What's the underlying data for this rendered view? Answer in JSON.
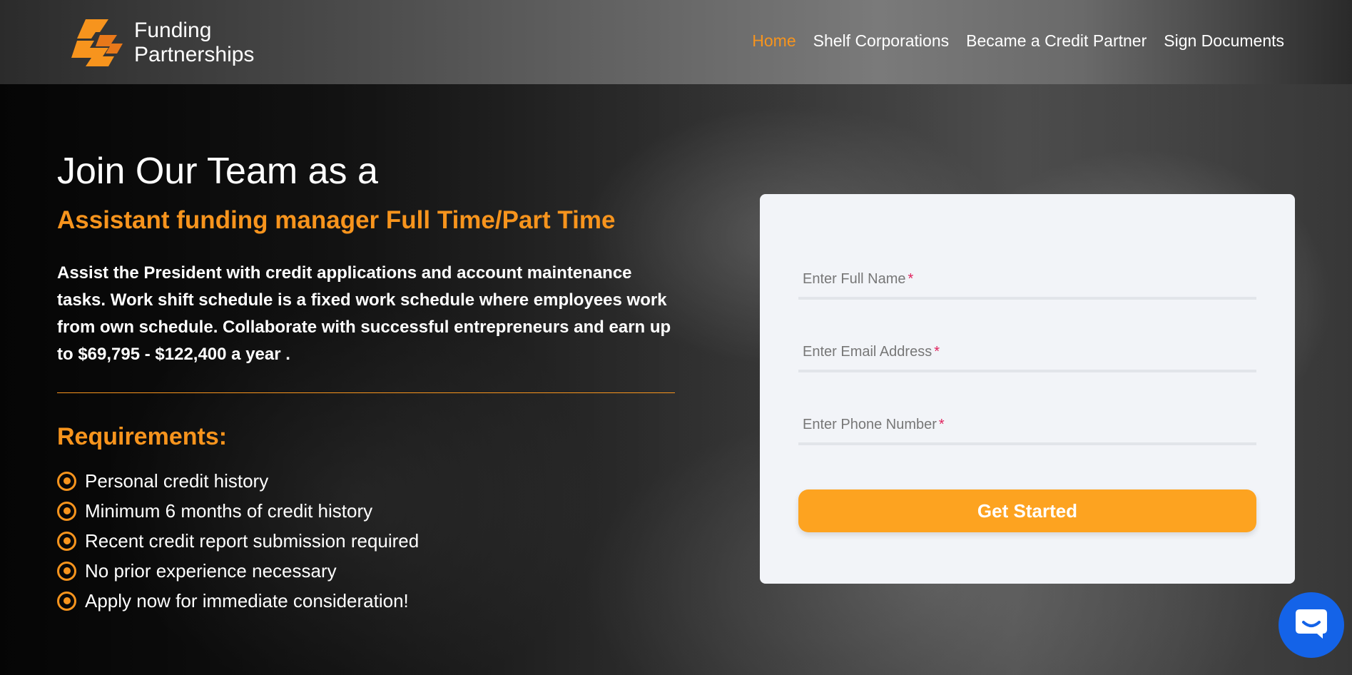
{
  "header": {
    "logo_line1": "Funding",
    "logo_line2": "Partnerships",
    "nav": [
      {
        "label": "Home",
        "active": true
      },
      {
        "label": "Shelf Corporations",
        "active": false
      },
      {
        "label": "Became a Credit Partner",
        "active": false
      },
      {
        "label": "Sign Documents",
        "active": false
      }
    ]
  },
  "hero": {
    "title": "Join Our Team as a",
    "subtitle": "Assistant funding manager Full Time/Part Time",
    "description": "Assist the President with credit applications and account maintenance tasks. Work shift schedule is a fixed work schedule where employees work from own schedule. Collaborate with successful entrepreneurs and earn up to $69,795 - $122,400 a year .",
    "requirements_title": "Requirements:",
    "requirements": [
      "Personal credit history",
      "Minimum 6 months of credit history",
      "Recent credit report submission required",
      "No prior experience necessary",
      "Apply now for immediate consideration!"
    ]
  },
  "form": {
    "full_name_placeholder": "Enter Full Name",
    "email_placeholder": "Enter Email Address",
    "phone_placeholder": "Enter Phone Number",
    "required_mark": "*",
    "submit_label": "Get Started"
  },
  "colors": {
    "accent": "#f7941d",
    "button": "#fda320",
    "chat": "#1463e8",
    "required": "#e0245e"
  },
  "icons": {
    "logo": "funding-partnerships-logo-icon",
    "bullet": "circle-dot-icon",
    "chat": "chat-bubble-icon"
  }
}
